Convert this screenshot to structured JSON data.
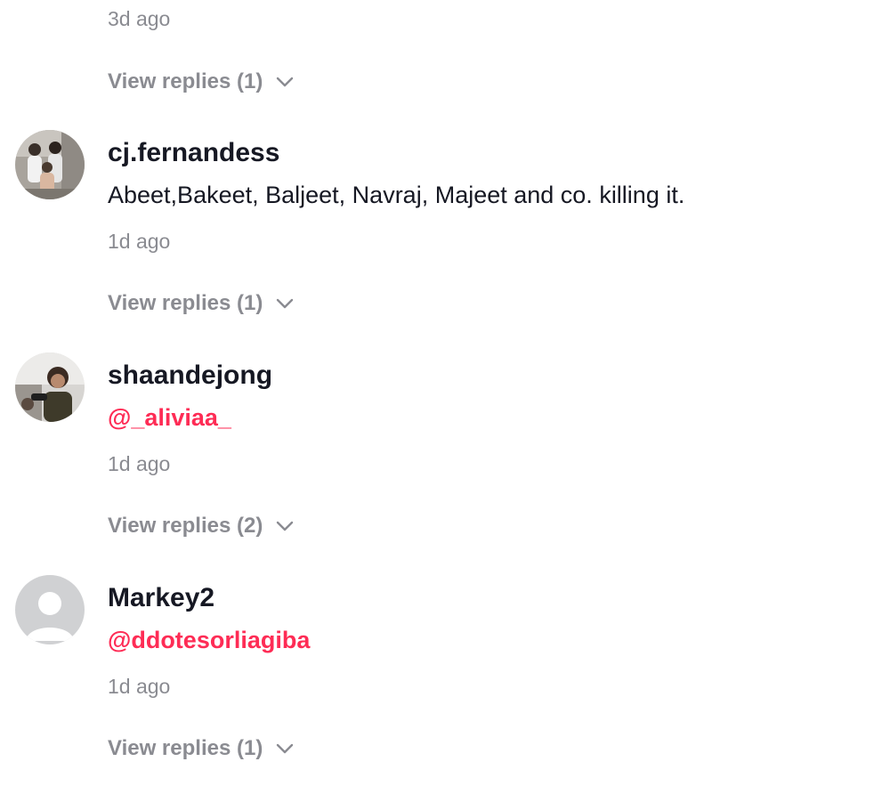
{
  "top": {
    "timestamp": "3d ago",
    "view_replies": "View replies (1)"
  },
  "comments": [
    {
      "username": "cj.fernandess",
      "text": "Abeet,Bakeet, Baljeet, Navraj, Majeet and co. killing it.",
      "timestamp": "1d ago",
      "view_replies": "View replies (1)"
    },
    {
      "username": "shaandejong",
      "mention": "@_aliviaa_",
      "timestamp": "1d ago",
      "view_replies": "View replies (2)"
    },
    {
      "username": "Markey2",
      "mention": "@ddotesorliagiba",
      "timestamp": "1d ago",
      "view_replies": "View replies (1)"
    }
  ],
  "colors": {
    "mention": "#fe2c55",
    "secondary_text": "#8a8b91",
    "primary_text": "#161823"
  }
}
